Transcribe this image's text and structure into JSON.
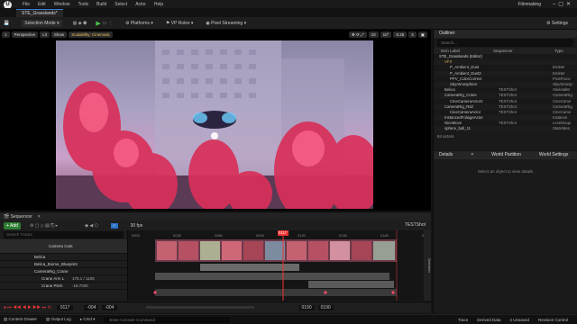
{
  "menubar": {
    "items": [
      "File",
      "Edit",
      "Window",
      "Tools",
      "Build",
      "Select",
      "Actor",
      "Help"
    ],
    "right_title": "Filmmaking"
  },
  "tab": {
    "label": "STE_Grasslands*"
  },
  "toolbar": {
    "mode": "Selection Mode",
    "platforms": "Platforms",
    "vp_roles": "VP Roles",
    "pixel_streaming": "Pixel Streaming",
    "settings": "Settings"
  },
  "viewport": {
    "perspective": "Perspective",
    "lit": "Lit",
    "show": "Show",
    "scalability": "Scalability: Cinematic",
    "grid": "10",
    "angle": "10°",
    "scale": "0.25",
    "speed": "4"
  },
  "outliner": {
    "title": "Outliner",
    "search_placeholder": "Search...",
    "col_label": "Item Label",
    "col_sequencer": "Sequencer",
    "col_type": "Type",
    "items": [
      {
        "label": "STE_Grasslands (Editor)",
        "type": "",
        "indent": 0,
        "color": "#d8d8d8"
      },
      {
        "label": "VFX",
        "type": "",
        "indent": 1,
        "color": "#d8b060"
      },
      {
        "label": "P_Ambient_Dust",
        "type": "Emitter",
        "indent": 2,
        "color": "#c4c4c4"
      },
      {
        "label": "P_Ambient_Dust2",
        "type": "Emitter",
        "indent": 2,
        "color": "#c4c4c4"
      },
      {
        "label": "PPV_ColorCorrect",
        "type": "PostProce",
        "indent": 2,
        "color": "#c4c4c4"
      },
      {
        "label": "SkyAtmosphere",
        "type": "SkyAtmosp",
        "indent": 2,
        "color": "#c4c4c4"
      },
      {
        "label": "Belica",
        "type": "SkeletalM",
        "seq": "TESTShot",
        "indent": 1,
        "color": "#c4c4c4"
      },
      {
        "label": "CameraRig_Crane",
        "type": "CameraRig",
        "seq": "TESTShot",
        "indent": 1,
        "color": "#c4c4c4"
      },
      {
        "label": "CineCameraActor2",
        "type": "CineCame",
        "seq": "TESTShot",
        "indent": 2,
        "color": "#c4c4c4"
      },
      {
        "label": "CameraRig_Rail",
        "type": "CameraRig",
        "seq": "TESTShot",
        "indent": 1,
        "color": "#c4c4c4"
      },
      {
        "label": "CineCameraActor",
        "type": "CineCame",
        "seq": "TESTShot",
        "indent": 2,
        "color": "#c4c4c4"
      },
      {
        "label": "InstancedFoliageActor",
        "type": "Instance",
        "indent": 1,
        "color": "#c4c4c4"
      },
      {
        "label": "NiceMove",
        "type": "LevelSequ",
        "seq": "TESTShot",
        "indent": 1,
        "color": "#c4c4c4"
      },
      {
        "label": "sphere_ball_11",
        "type": "StaticMes",
        "indent": 1,
        "color": "#c4c4c4"
      }
    ],
    "count": "84 actors"
  },
  "details": {
    "title": "Details",
    "close": "×",
    "world_partition": "World Partition",
    "world_settings": "World Settings",
    "empty": "Select an object to view details"
  },
  "sequencer": {
    "title": "Sequencer",
    "close": "×",
    "add": "+ Add",
    "fps": "30 fps",
    "name": "TESTShot",
    "frame_marker": "0117",
    "track_header": "Camera Cuts",
    "search_placeholder": "Search Tracks",
    "tracks": [
      {
        "label": "Belica",
        "indent": 1
      },
      {
        "label": "Belica_Biome_Blueprint",
        "indent": 1
      },
      {
        "label": "CameraRig_Crane",
        "indent": 1
      },
      {
        "label": "Crane Arm L",
        "value": "175.1 / 1105",
        "indent": 2
      },
      {
        "label": "Crane Pitch",
        "value": "-18.7000",
        "indent": 2
      }
    ],
    "ticks": [
      "0000",
      "0030",
      "0060",
      "0090",
      "0120",
      "0150",
      "0180",
      "0210"
    ],
    "range_start": "-004",
    "range_start2": "-004",
    "current": "0117",
    "range_end": "0190",
    "range_end2": "0190",
    "sidebar_label": "Selection"
  },
  "statusbar": {
    "items": [
      "Content Drawer",
      "Output Log",
      "Cmd"
    ],
    "cmd_placeholder": "Enter Console Command",
    "right": [
      "Trace",
      "Derived Data",
      "2 Unsaved",
      "Revision Control"
    ]
  }
}
